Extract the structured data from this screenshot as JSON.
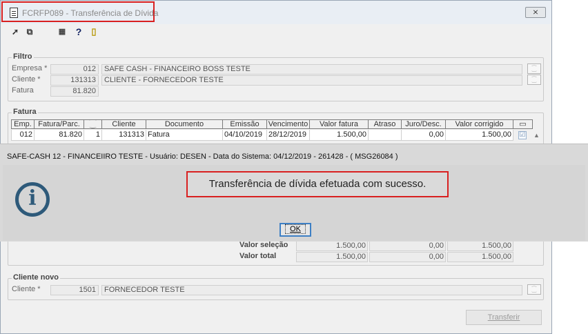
{
  "window": {
    "title": "FCRFP089 - Transferência de Dívida",
    "close_label": "⨯"
  },
  "toolbar": {
    "icons": [
      "arrow-icon",
      "copy-icon",
      "calendar-icon",
      "help-icon",
      "exit-icon"
    ]
  },
  "filtro": {
    "legend": "Filtro",
    "empresa_label": "Empresa *",
    "empresa_code": "012",
    "empresa_name": "SAFE CASH - FINANCEIRO BOSS TESTE",
    "cliente_label": "Cliente *",
    "cliente_code": "131313",
    "cliente_name": "CLIENTE - FORNECEDOR TESTE",
    "fatura_label": "Fatura",
    "fatura_value": "81.820"
  },
  "fatura": {
    "legend": "Fatura",
    "columns": [
      "Emp.",
      "Fatura/Parc.",
      "⁐",
      "Cliente",
      "Documento",
      "Emissão",
      "Vencimento",
      "Valor fatura",
      "Atraso",
      "Juro/Desc.",
      "Valor corrigido",
      "▭"
    ],
    "row": {
      "emp": "012",
      "fatura": "81.820",
      "parc": "1",
      "cliente": "131313",
      "documento": "Fatura",
      "emissao": "04/10/2019",
      "vencimento": "28/12/2019",
      "valor_fatura": "1.500,00",
      "atraso": "",
      "juro": "0,00",
      "valor_corrigido": "1.500,00",
      "checked": "☑"
    }
  },
  "totais": {
    "selecao_label": "Valor seleção",
    "selecao": [
      "1.500,00",
      "0,00",
      "1.500,00"
    ],
    "total_label": "Valor total",
    "total": [
      "1.500,00",
      "0,00",
      "1.500,00"
    ]
  },
  "cliente_novo": {
    "legend": "Cliente novo",
    "cliente_label": "Cliente *",
    "cliente_code": "1501",
    "cliente_name": "FORNECEDOR TESTE"
  },
  "buttons": {
    "transferir": "Transferir"
  },
  "dialog": {
    "title": "SAFE-CASH 12 - FINANCEIIRO TESTE - Usuário: DESEN - Data do Sistema: 04/12/2019 - 261428 - ( MSG26084 )",
    "message": "Transferência de dívida efetuada com sucesso.",
    "ok_label": "OK",
    "icon": "info-icon"
  }
}
